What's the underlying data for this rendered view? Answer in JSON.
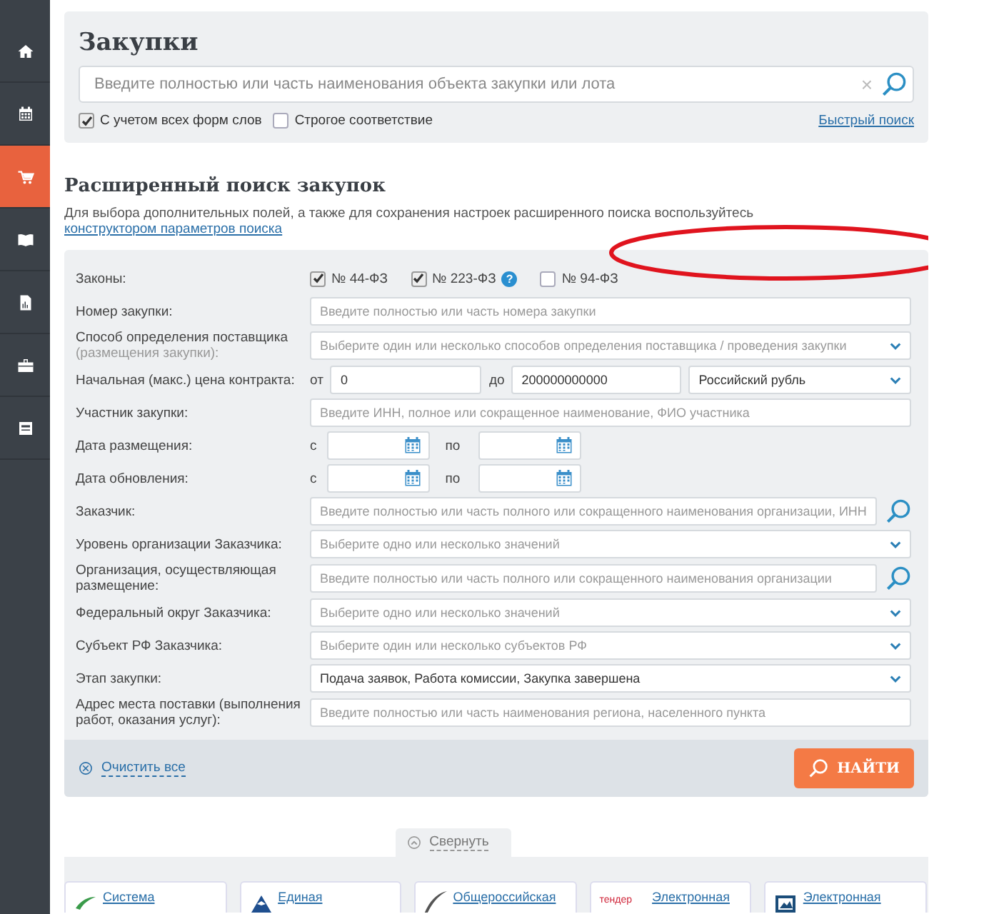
{
  "sidebar": {
    "items": [
      {
        "kind": "home",
        "selected": false
      },
      {
        "kind": "calendar",
        "selected": false
      },
      {
        "kind": "cart",
        "selected": true
      },
      {
        "kind": "book",
        "selected": false
      },
      {
        "kind": "document",
        "selected": false
      },
      {
        "kind": "briefcase",
        "selected": false
      },
      {
        "kind": "card",
        "selected": false
      }
    ]
  },
  "quick_search": {
    "title": "Закупки",
    "placeholder": "Введите полностью или часть наименования объекта закупки или лота",
    "clear": "×",
    "options": [
      {
        "label": "С учетом всех форм слов",
        "checked": true
      },
      {
        "label": "Строгое соответствие",
        "checked": false
      }
    ],
    "link": "Быстрый поиск"
  },
  "advanced": {
    "title": "Расширенный поиск закупок",
    "note": "Для выбора дополнительных полей, а также для сохранения настроек расширенного поиска воспользуйтесь",
    "note_link": "конструктором параметров поиска",
    "rows": [
      {
        "kind": "checks",
        "label": "Законы:",
        "checks": [
          {
            "label": "№ 44-ФЗ",
            "checked": true
          },
          {
            "label": "№ 223-ФЗ",
            "checked": true,
            "help": "?"
          },
          {
            "label": "№ 94-ФЗ",
            "checked": false
          }
        ]
      },
      {
        "kind": "input",
        "label": "Номер закупки:",
        "placeholder": "Введите полностью или часть номера закупки"
      },
      {
        "kind": "select",
        "label": "Способ определения поставщика",
        "sublabel": "(размещения закупки):",
        "placeholder": "Выберите один или несколько способов определения поставщика / проведения закупки"
      },
      {
        "kind": "range",
        "label": "Начальная (макс.) цена контракта:",
        "from_label": "от",
        "from_value": "0",
        "to_label": "до",
        "to_value": "200000000000",
        "currency": "Российский рубль"
      },
      {
        "kind": "input",
        "label": "Участник закупки:",
        "placeholder": "Введите ИНН, полное или сокращенное наименование, ФИО участника"
      },
      {
        "kind": "dates",
        "label": "Дата размещения:",
        "from_label": "с",
        "to_label": "по"
      },
      {
        "kind": "dates",
        "label": "Дата обновления:",
        "from_label": "с",
        "to_label": "по"
      },
      {
        "kind": "search",
        "label": "Заказчик:",
        "placeholder": "Введите полностью или часть полного или сокращенного наименования организации, ИНН"
      },
      {
        "kind": "select",
        "label": "Уровень организации Заказчика:",
        "placeholder": "Выберите одно или несколько значений"
      },
      {
        "kind": "search",
        "label": "Организация, осуществляющая размещение:",
        "placeholder": "Введите полностью или часть полного или сокращенного наименования организации"
      },
      {
        "kind": "select",
        "label": "Федеральный округ Заказчика:",
        "placeholder": "Выберите одно или несколько значений"
      },
      {
        "kind": "select",
        "label": "Субъект РФ Заказчика:",
        "placeholder": "Выберите один или несколько субъектов РФ"
      },
      {
        "kind": "select",
        "label": "Этап закупки:",
        "value": "Подача заявок, Работа комиссии, Закупка завершена"
      },
      {
        "kind": "input",
        "label": "Адрес места поставки (выполнения работ, оказания услуг):",
        "placeholder": "Введите полностью или часть наименования региона, населенного пункта"
      }
    ],
    "clear": "Очистить все",
    "submit": "НАЙТИ"
  },
  "collapse": "Свернуть",
  "partners": [
    {
      "kind": "leaf",
      "name": "Система"
    },
    {
      "kind": "mountain",
      "name": "Единая"
    },
    {
      "kind": "swoosh",
      "name": "Общероссийская"
    },
    {
      "kind": "tender",
      "logo_text": "тендер",
      "name": "Электронная"
    },
    {
      "kind": "frame",
      "name": "Электронная"
    }
  ],
  "annotation": {
    "kind": "ellipse",
    "color": "#e0141e"
  }
}
